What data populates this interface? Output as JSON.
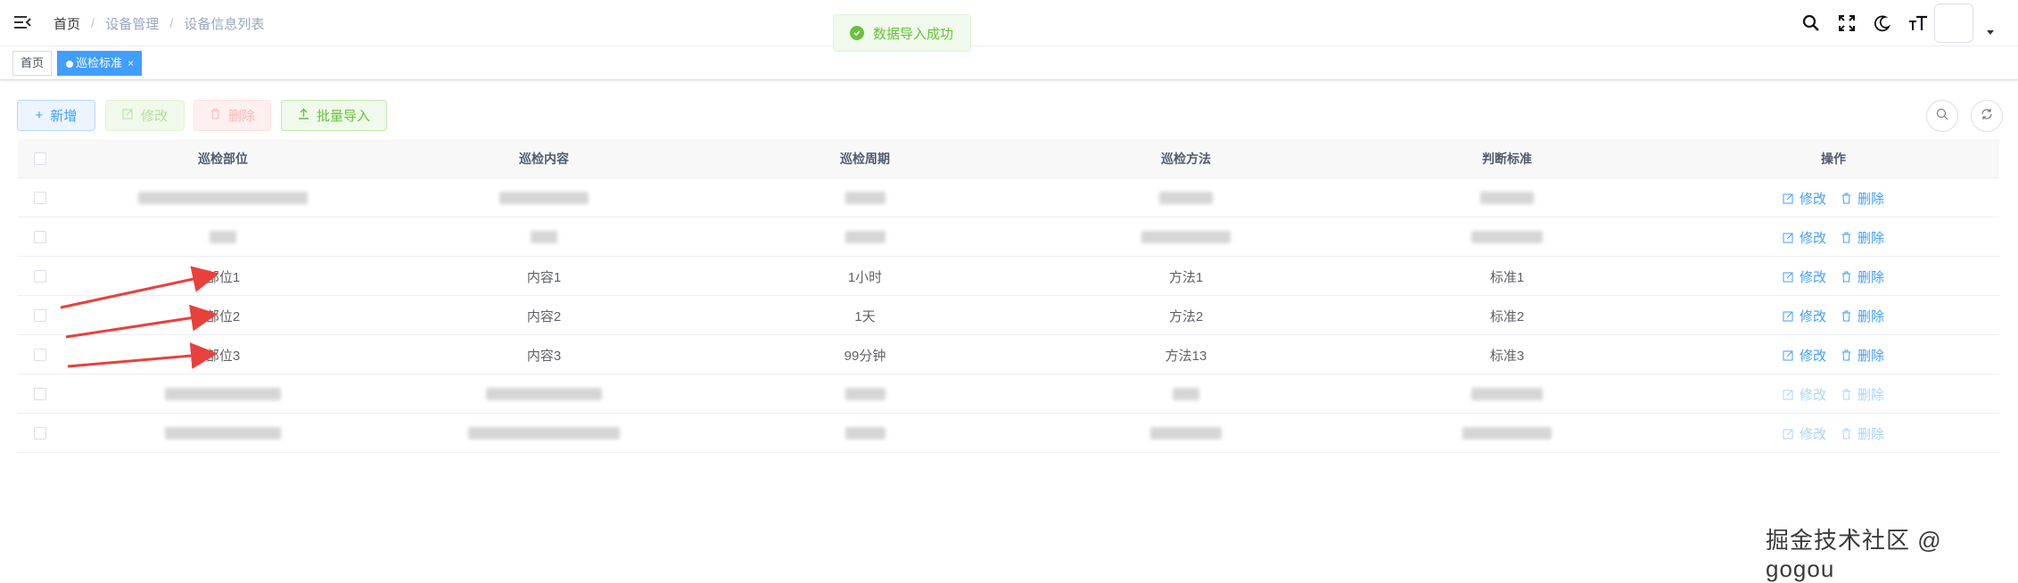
{
  "breadcrumb": [
    "首页",
    "设备管理",
    "设备信息列表"
  ],
  "breadcrumb_sep": "/",
  "tags": [
    {
      "label": "首页",
      "active": false
    },
    {
      "label": "巡检标准",
      "active": true,
      "close": "×"
    }
  ],
  "toast": {
    "message": "数据导入成功",
    "color": "#67c23a"
  },
  "toolbar": {
    "add": "新增",
    "edit": "修改",
    "delete": "删除",
    "import": "批量导入"
  },
  "table": {
    "columns": [
      "巡检部位",
      "巡检内容",
      "巡检周期",
      "巡检方法",
      "判断标准",
      "操作"
    ],
    "rows": [
      {
        "cells": [
          "",
          "",
          "",
          "",
          ""
        ],
        "blurred": true
      },
      {
        "cells": [
          "",
          "",
          "",
          "",
          ""
        ],
        "blurred": true
      },
      {
        "cells": [
          "部位1",
          "内容1",
          "1小时",
          "方法1",
          "标准1"
        ],
        "blurred": false
      },
      {
        "cells": [
          "部位2",
          "内容2",
          "1天",
          "方法2",
          "标准2"
        ],
        "blurred": false
      },
      {
        "cells": [
          "部位3",
          "内容3",
          "99分钟",
          "方法13",
          "标准3"
        ],
        "blurred": false
      },
      {
        "cells": [
          "",
          "",
          "",
          "",
          ""
        ],
        "blurred": true
      },
      {
        "cells": [
          "",
          "",
          "",
          "",
          ""
        ],
        "blurred": true
      }
    ],
    "row_actions": {
      "edit": "修改",
      "delete": "删除"
    }
  },
  "colors": {
    "primary": "#409eff",
    "success": "#67c23a",
    "danger": "#f56c6c",
    "arrow": "#e8413c"
  },
  "watermark": "掘金技术社区 @ gogou"
}
